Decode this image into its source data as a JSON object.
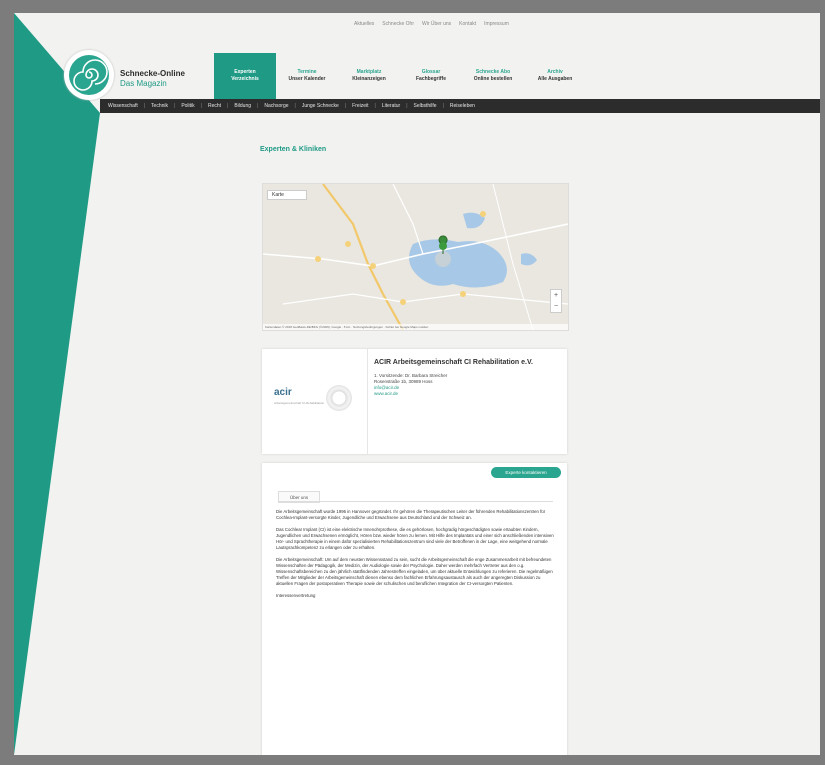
{
  "top_links": [
    "Aktuelles",
    "Schnecke Ohr",
    "Wir Über uns",
    "Kontakt",
    "Impressum"
  ],
  "brand": {
    "title": "Schnecke-Online",
    "subtitle": "Das Magazin"
  },
  "main_nav": [
    {
      "top": "Experten",
      "bottom": "Verzeichnis",
      "active": true
    },
    {
      "top": "Termine",
      "bottom": "Unser Kalender",
      "active": false
    },
    {
      "top": "Marktplatz",
      "bottom": "Kleinanzeigen",
      "active": false
    },
    {
      "top": "Glossar",
      "bottom": "Fachbegriffe",
      "active": false
    },
    {
      "top": "Schnecke Abo",
      "bottom": "Online bestellen",
      "active": false
    },
    {
      "top": "Archiv",
      "bottom": "Alle Ausgaben",
      "active": false
    }
  ],
  "categories": [
    "Wissenschaft",
    "Technik",
    "Politik",
    "Recht",
    "Bildung",
    "Nachsorge",
    "Junge Schnecke",
    "Freizeit",
    "Literatur",
    "Selbsthilfe",
    "Reiseleben"
  ],
  "section_title": "Experten & Kliniken",
  "map": {
    "select_label": "Karte",
    "zoom_in": "+",
    "zoom_out": "−",
    "attribution": "Kartendaten © 2018 GeoBasis-DE/BKG (©2009), Google · 5 km · Nutzungsbedingungen · Fehler bei Google Maps melden"
  },
  "card": {
    "logo_text": "acir",
    "logo_sub": "Arbeitsgemeinschaft CI-Rehabilitation",
    "title": "ACIR Arbeitsgemeinschaft CI Rehabilitation e.V.",
    "line1": "1. Vorsitzende: Dr. Barbara Streicher",
    "line2": "Rosenstraße 1b, 30989 Hoss",
    "line3": "info@acir.de",
    "line4": "www.acir.de"
  },
  "contact_button": "Experte kontaktieren",
  "tab_label": "Über uns",
  "description": [
    "Die Arbeitsgemeinschaft wurde 1996 in Hannover gegründet. Ihr gehören die Therapeutischen Leiter der führenden Rehabilitationszentren für Cochlea-Implant-versorgte Kinder, Jugendliche und Erwachsene aus Deutschland und der Schweiz an.",
    "Das Cochlear Implant (CI) ist eine elektrische Innenohrprothese, die es gehörlosen, hochgradig hörgeschädigten sowie ertaubten Kindern, Jugendlichen und Erwachsenen ermöglicht, Hören bzw. wieder hören zu lernen. Mit Hilfe des Implantats und einer sich anschließenden intensiven Hör- und Sprachtherapie in einem dafür spezialisierten Rehabilitationszentrum sind viele der Betroffenen in der Lage, eine weitgehend normale Lautsprachkompetenz zu erlangen oder zu erhalten.",
    "Die Arbeitsgemeinschaft: Um auf dem neusten Wissensstand zu sein, sucht die Arbeitsgemeinschaft die enge Zusammenarbeit mit befreundeten Wissenschaften der Pädagogik, der Medizin, der Audiologie sowie der Psychologie. Daher werden mehrfach Vertreter aus den o.g. Wissenschaftsbereichen zu den jährlich stattfindenden Jahrestreffen eingeladen, um über aktuelle Entwicklungen zu referieren. Die regelmäßigen Treffen der Mitglieder der Arbeitsgemeinschaft dienen ebenso dem fachlichen Erfahrungsaustausch als auch der angeregten Diskussion zu aktuellen Fragen der postoperativen Therapie sowie der schulischen und beruflichen Integration der CI-versorgten Patienten.",
    "Interessenvertretung"
  ],
  "colors": {
    "brand_green": "#1f9a85",
    "dark_bar": "#2c2c2c"
  }
}
